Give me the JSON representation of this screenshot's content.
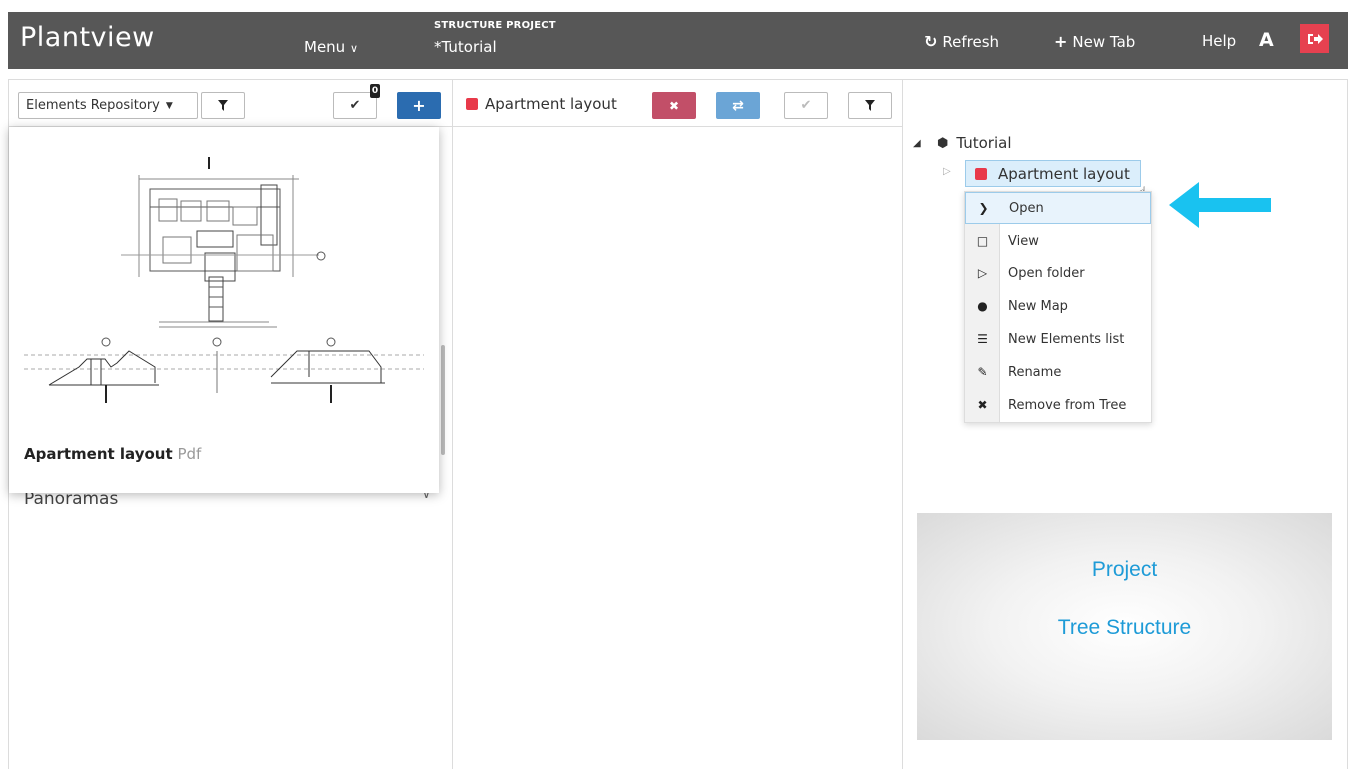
{
  "header": {
    "brand": "Plantview",
    "menu_label": "Menu",
    "project_label": "STRUCTURE PROJECT",
    "project_name": "*Tutorial",
    "refresh_label": "Refresh",
    "new_tab_label": "New Tab",
    "help_label": "Help",
    "user_initial": "A"
  },
  "left_panel": {
    "repo_select": "Elements Repository",
    "badge_count": "0",
    "preview": {
      "name": "Apartment layout",
      "type": "Pdf"
    },
    "list_item": "Panoramas"
  },
  "middle_panel": {
    "tab_title": "Apartment layout"
  },
  "tree": {
    "root_label": "Tutorial",
    "node_label": "Apartment layout"
  },
  "context_menu": {
    "items": [
      {
        "label": "Open",
        "icon": "chevron-down-icon"
      },
      {
        "label": "View",
        "icon": "monitor-icon"
      },
      {
        "label": "Open folder",
        "icon": "folder-open-icon"
      },
      {
        "label": "New Map",
        "icon": "globe-icon"
      },
      {
        "label": "New Elements list",
        "icon": "list-icon"
      },
      {
        "label": "Rename",
        "icon": "pencil-icon"
      },
      {
        "label": "Remove from Tree",
        "icon": "close-icon"
      }
    ]
  },
  "info_box": {
    "line1": "Project",
    "line2": "Tree Structure"
  },
  "colors": {
    "header_bg": "#575757",
    "accent_red": "#e8394a",
    "accent_blue": "#2b6cb0",
    "info_text": "#1e9bd7",
    "arrow": "#19c2f0"
  }
}
